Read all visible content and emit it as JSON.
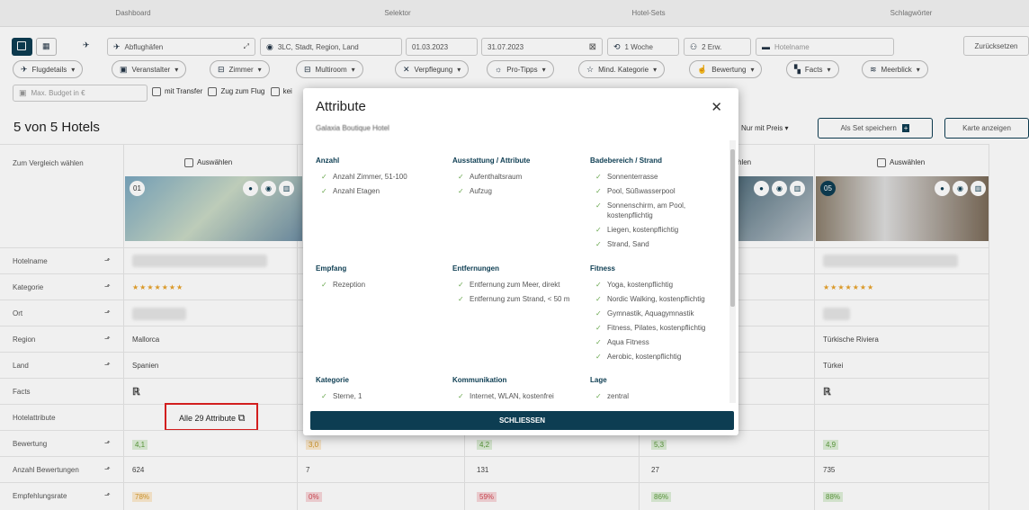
{
  "topnav": [
    "Dashboard",
    "Selektor",
    "Hotel-Sets",
    "Schlagwörter"
  ],
  "search": {
    "airports_placeholder": "Abflughäfen",
    "location_placeholder": "3LC, Stadt, Region, Land",
    "date_from": "01.03.2023",
    "date_to": "31.07.2023",
    "duration": "1 Woche",
    "travellers": "2 Erw.",
    "hotelname_placeholder": "Hotelname",
    "reset": "Zurücksetzen"
  },
  "pills": [
    "Flugdetails",
    "Veranstalter",
    "Zimmer",
    "Multiroom",
    "Verpflegung",
    "Pro-Tipps",
    "Mind. Kategorie",
    "Bewertung",
    "Facts",
    "Meerblick"
  ],
  "extra": {
    "budget_placeholder": "Max. Budget in €",
    "transfer": "mit Transfer",
    "train": "Zug zum Flug",
    "kein": "kei"
  },
  "results": {
    "title": "5 von 5 Hotels",
    "only_price": "Nur mit Preis",
    "save_set": "Als Set speichern",
    "map": "Karte anzeigen"
  },
  "compare": {
    "header": "Zum Vergleich wählen",
    "select": "Auswählen",
    "select_partial": "hlen",
    "img_nums": [
      "01",
      "05"
    ]
  },
  "rows": [
    {
      "label": "Hotelname",
      "sortable": true
    },
    {
      "label": "Kategorie",
      "sortable": true
    },
    {
      "label": "Ort",
      "sortable": true
    },
    {
      "label": "Region",
      "sortable": true
    },
    {
      "label": "Land",
      "sortable": true
    },
    {
      "label": "Facts",
      "sortable": false
    },
    {
      "label": "Hotelattribute",
      "sortable": false
    },
    {
      "label": "Bewertung",
      "sortable": true
    },
    {
      "label": "Anzahl Bewertungen",
      "sortable": true
    },
    {
      "label": "Empfehlungsrate",
      "sortable": true
    }
  ],
  "col1": {
    "stars": "★★★★★★★",
    "region": "Mallorca",
    "land": "Spanien",
    "attributes": "Alle 29 Attribute",
    "rating": "4,1",
    "reviews": "624",
    "recommend": "78%"
  },
  "col2": {
    "rating": "3,0",
    "reviews": "7",
    "recommend": "0%"
  },
  "col3": {
    "rating": "4,2",
    "reviews": "131",
    "recommend": "59%"
  },
  "col4": {
    "rating": "5,3",
    "reviews": "27",
    "recommend": "86%"
  },
  "col5": {
    "stars": "★★★★★★★",
    "region": "Türkische Riviera",
    "land": "Türkei",
    "rating": "4,9",
    "reviews": "735",
    "recommend": "88%"
  },
  "modal": {
    "title": "Attribute",
    "hotel": "Galaxia Boutique Hotel",
    "close_label": "SCHLIESSEN",
    "sections": [
      {
        "title": "Anzahl",
        "items": [
          "Anzahl Zimmer, 51-100",
          "Anzahl Etagen"
        ]
      },
      {
        "title": "Ausstattung / Attribute",
        "items": [
          "Aufenthaltsraum",
          "Aufzug"
        ]
      },
      {
        "title": "Badebereich / Strand",
        "items": [
          "Sonnenterrasse",
          "Pool, Süßwasserpool",
          "Sonnenschirm, am Pool, kostenpflichtig",
          "Liegen, kostenpflichtig",
          "Strand, Sand"
        ]
      },
      {
        "title": "Empfang",
        "items": [
          "Rezeption"
        ]
      },
      {
        "title": "Entfernungen",
        "items": [
          "Entfernung zum Meer, direkt",
          "Entfernung zum Strand, < 50 m"
        ]
      },
      {
        "title": "Fitness",
        "items": [
          "Yoga, kostenpflichtig",
          "Nordic Walking, kostenpflichtig",
          "Gymnastik, Aquagymnastik",
          "Fitness, Pilates, kostenpflichtig",
          "Aqua Fitness",
          "Aerobic, kostenpflichtig"
        ]
      },
      {
        "title": "Kategorie",
        "items": [
          "Sterne, 1"
        ]
      },
      {
        "title": "Kommunikation",
        "items": [
          "Internet, WLAN, kostenfrei"
        ]
      },
      {
        "title": "Lage",
        "items": [
          "zentral"
        ]
      }
    ]
  }
}
